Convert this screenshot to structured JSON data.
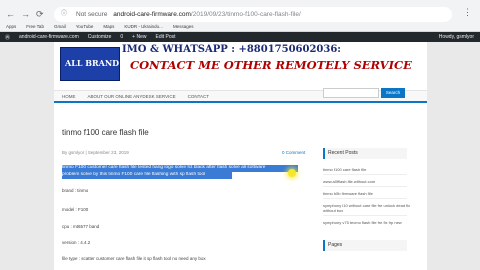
{
  "browser": {
    "url_host": "android-care-firmware.com",
    "url_path": "/2019/09/23/tinmo-f100-care-flash-file/",
    "not_secure": "Not secure",
    "bookmarks": [
      "Apps",
      "Free Tab",
      "Gmail",
      "YouTube",
      "Maps",
      "KUDR - Ukraindo...",
      "Messages"
    ]
  },
  "adminbar": {
    "site": "android-care-firmware.com",
    "customize": "Customize",
    "comments": "0",
    "new": "+ New",
    "edit": "Edit Post",
    "howdy": "Howdy, gsmlyor"
  },
  "banner": {
    "logo": "ALL BRAND",
    "line1": "IMO & WHATSAPP : +8801750602036:",
    "line2": "CONTACT ME OTHER REMOTELY SERVICE"
  },
  "nav": [
    "HOME",
    "ABOUT OUR ONLINE ANYDESK SERVICE",
    "CONTACT"
  ],
  "post": {
    "title": "tinmo f100 care flash file",
    "meta": "By gsmlyor | September 23, 2019",
    "comments": "0 Comment",
    "highlight1": "tinmo F100 customer care flash file tested hang logo solve fct black after flash solve all software",
    "highlight2": "problem solve by this tinmo F100 care file flashing with sp flash tool",
    "brand": "brand : tinmo",
    "model": "model : F100",
    "cpu": "cpu : mt6577 band",
    "version": "version : 4.4.2",
    "filetype": "file type : scatter customer care flash file it sp flash tool no need any box"
  },
  "sidebar": {
    "search_button": "Search",
    "recent_posts": "Recent Posts",
    "posts": [
      "tinmo f100 care flash file",
      "www.a0fflash.file.without.com",
      "tinmo b5b firmware flash file",
      "symphony i10 without care file fre unlock dead fix without box",
      "symphony v75 tecmo flash file fre fix frp new"
    ],
    "pages": "Pages"
  }
}
